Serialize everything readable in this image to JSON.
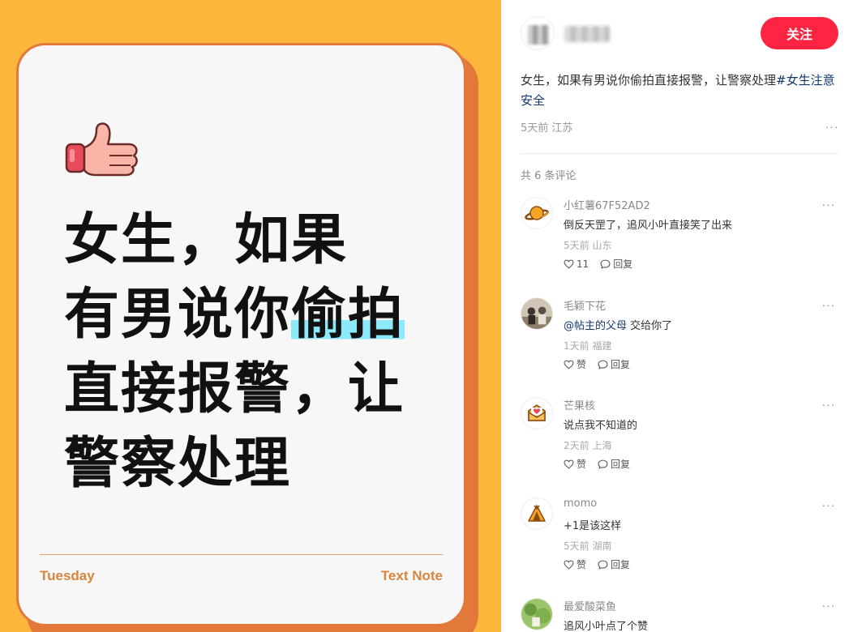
{
  "image_card": {
    "lines": [
      "女生，如果",
      "有男说你",
      "直接报警，让",
      "警察处理"
    ],
    "highlight": "偷拍",
    "footer_left": "Tuesday",
    "footer_right": "Text Note",
    "icon": "thumbs-up-icon"
  },
  "author": {
    "follow_label": "关注"
  },
  "post": {
    "text": "女生，如果有男说你偷拍直接报警，让警察处理",
    "hashtag": "#女生注意安全",
    "time": "5天前",
    "location": "江苏",
    "more": "···"
  },
  "comments_header": "共 6 条评论",
  "comments": [
    {
      "name": "小红薯67F52AD2",
      "text": "倒反天罡了，追风小叶直接笑了出来",
      "time": "5天前",
      "location": "山东",
      "likes": "11",
      "reply": "回复",
      "avatar_icon": "planet-icon"
    },
    {
      "name": "毛颖下花",
      "mention": "@帖主的父母",
      "text": " 交给你了",
      "time": "1天前",
      "location": "福建",
      "likes": "赞",
      "reply": "回复",
      "avatar_icon": "photo-avatar-icon"
    },
    {
      "name": "芒果核",
      "text": "说点我不知道的",
      "time": "2天前",
      "location": "上海",
      "likes": "赞",
      "reply": "回复",
      "avatar_icon": "love-letter-icon"
    },
    {
      "name": "momo",
      "text": "+1是该这样",
      "time": "5天前",
      "location": "湖南",
      "likes": "赞",
      "reply": "回复",
      "avatar_icon": "tent-icon"
    },
    {
      "name": "最爱酸菜鱼",
      "text": "追风小叶点了个赞",
      "time": "",
      "location": "",
      "likes": "",
      "reply": "",
      "avatar_icon": "photo-avatar-icon"
    }
  ],
  "colors": {
    "background_orange": "#fdb63c",
    "card_border": "#e2793a",
    "highlight": "#8be9fb",
    "follow_button": "#ff2442",
    "hashtag": "#13386c"
  }
}
